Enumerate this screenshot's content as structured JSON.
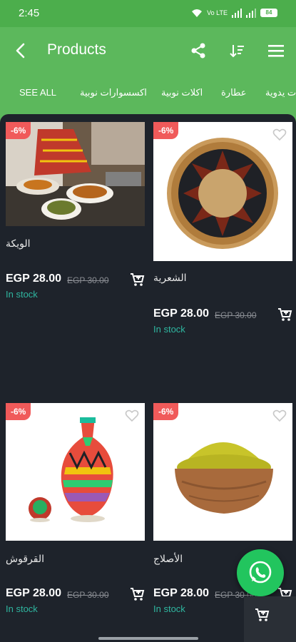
{
  "status": {
    "time": "2:45",
    "network": "Vo LTE",
    "battery": "84"
  },
  "app_bar": {
    "title": "Products"
  },
  "categories": [
    {
      "label": "SEE ALL"
    },
    {
      "label": "اكسسوارات نوبية"
    },
    {
      "label": "اكلات نوبية"
    },
    {
      "label": "عطارة"
    },
    {
      "label": "مشغولات يدوية"
    }
  ],
  "products": [
    {
      "name": "الويكة",
      "discount": "-6%",
      "price": "EGP 28.00",
      "old_price": "EGP 30.00",
      "stock": "In stock"
    },
    {
      "name": "الشعرية",
      "discount": "-6%",
      "price": "EGP 28.00",
      "old_price": "EGP 30.00",
      "stock": "In stock"
    },
    {
      "name": "القرقوش",
      "discount": "-6%",
      "price": "EGP 28.00",
      "old_price": "EGP 30.00",
      "stock": "In stock"
    },
    {
      "name": "الأصلاج",
      "discount": "-6%",
      "price": "EGP 28.00",
      "old_price": "EGP 30.00",
      "stock": "In stock"
    }
  ],
  "colors": {
    "brand": "#5cb85c",
    "badge": "#f05a5a",
    "stock": "#2fb6a0",
    "background": "#1e232b",
    "whatsapp": "#22c55e"
  },
  "icons": [
    "back-arrow-icon",
    "share-icon",
    "sort-icon",
    "menu-icon",
    "heart-icon",
    "add-to-cart-icon",
    "whatsapp-icon",
    "cart-icon"
  ]
}
